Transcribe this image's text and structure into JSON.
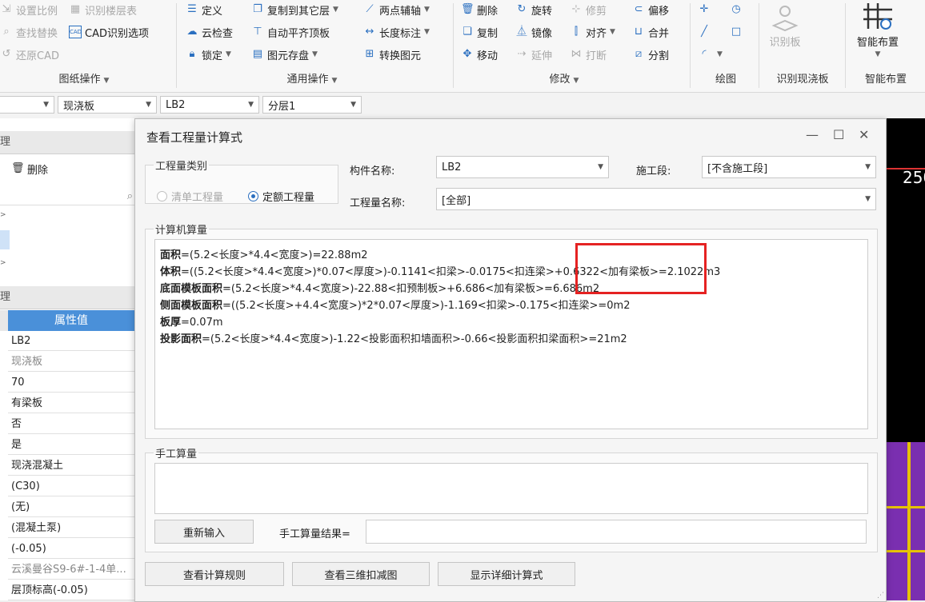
{
  "ribbon": {
    "drawing_ops": {
      "items": [
        {
          "label": "设置比例",
          "icon": "scale-icon",
          "enabled": false
        },
        {
          "label": "识别楼层表",
          "icon": "floor-table-icon",
          "enabled": false
        },
        {
          "label": "查找替换",
          "icon": "find-replace-icon",
          "enabled": false
        },
        {
          "label": "CAD识别选项",
          "icon": "cad-options-icon",
          "enabled": true
        },
        {
          "label": "还原CAD",
          "icon": "restore-cad-icon",
          "enabled": false
        }
      ],
      "group_label": "图纸操作"
    },
    "general_ops": {
      "items": [
        {
          "label": "定义",
          "icon": "define-icon"
        },
        {
          "label": "复制到其它层",
          "icon": "copy-to-layer-icon"
        },
        {
          "label": "两点辅轴",
          "icon": "two-point-axis-icon"
        },
        {
          "label": "云检查",
          "icon": "cloud-check-icon"
        },
        {
          "label": "自动平齐顶板",
          "icon": "auto-align-top-icon"
        },
        {
          "label": "长度标注",
          "icon": "length-dimension-icon"
        },
        {
          "label": "锁定",
          "icon": "lock-icon"
        },
        {
          "label": "图元存盘",
          "icon": "save-element-icon"
        },
        {
          "label": "转换图元",
          "icon": "convert-element-icon"
        }
      ],
      "group_label": "通用操作"
    },
    "modify": {
      "items": [
        {
          "label": "删除",
          "icon": "delete-icon",
          "enabled": true
        },
        {
          "label": "旋转",
          "icon": "rotate-icon",
          "enabled": true
        },
        {
          "label": "修剪",
          "icon": "trim-icon",
          "enabled": false
        },
        {
          "label": "偏移",
          "icon": "offset-icon",
          "enabled": true
        },
        {
          "label": "复制",
          "icon": "copy-icon",
          "enabled": true
        },
        {
          "label": "镜像",
          "icon": "mirror-icon",
          "enabled": true
        },
        {
          "label": "对齐",
          "icon": "align-icon",
          "enabled": true
        },
        {
          "label": "合并",
          "icon": "merge-icon",
          "enabled": true
        },
        {
          "label": "移动",
          "icon": "move-icon",
          "enabled": true
        },
        {
          "label": "延伸",
          "icon": "extend-icon",
          "enabled": false
        },
        {
          "label": "打断",
          "icon": "break-icon",
          "enabled": false
        },
        {
          "label": "分割",
          "icon": "split-icon",
          "enabled": true
        }
      ],
      "group_label": "修改"
    },
    "draw": {
      "group_label": "绘图"
    },
    "identify_slab": {
      "button_label": "识别板",
      "group_label": "识别现浇板"
    },
    "smart_layout": {
      "button_label": "智能布置",
      "group_label": "智能布置"
    }
  },
  "toolbar2": {
    "type_value": "现浇板",
    "component_value": "LB2",
    "layer_value": "分层1"
  },
  "left_panel": {
    "header1": "理",
    "delete_label": "删除",
    "header2": "理",
    "prop_col_header": "属性值",
    "props": [
      "LB2",
      "现浇板",
      "70",
      "有梁板",
      "否",
      "是",
      "现浇混凝土",
      "(C30)",
      "(无)",
      "(混凝土泵)",
      "(-0.05)",
      "云溪曼谷S9-6#-1-4单...",
      "层顶标高(-0.05)"
    ]
  },
  "canvas_right": {
    "number_text": "250"
  },
  "dialog": {
    "title": "查看工程量计算式",
    "qty_category_legend": "工程量类别",
    "radio_list": "清单工程量",
    "radio_quota": "定额工程量",
    "component_name_label": "构件名称:",
    "component_name_value": "LB2",
    "stage_label": "施工段:",
    "stage_value": "[不含施工段]",
    "qty_name_label": "工程量名称:",
    "qty_name_value": "[全部]",
    "computer_calc_legend": "计算机算量",
    "lines": [
      {
        "name": "面积",
        "expr": "=(5.2<长度>*4.4<宽度>)=22.88m2"
      },
      {
        "name": "体积",
        "expr": "=((5.2<长度>*4.4<宽度>)*0.07<厚度>)-0.1141<扣梁>-0.0175<扣连梁>+0.6322<加有梁板>=2.1022m3"
      },
      {
        "name": "底面模板面积",
        "expr": "=(5.2<长度>*4.4<宽度>)-22.88<扣预制板>+6.686<加有梁板>=6.686m2"
      },
      {
        "name": "侧面模板面积",
        "expr": "=((5.2<长度>+4.4<宽度>)*2*0.07<厚度>)-1.169<扣梁>-0.175<扣连梁>=0m2"
      },
      {
        "name": "板厚",
        "expr": "=0.07m"
      },
      {
        "name": "投影面积",
        "expr": "=(5.2<长度>*4.4<宽度>)-1.22<投影面积扣墙面积>-0.66<投影面积扣梁面积>=21m2"
      }
    ],
    "manual_calc_legend": "手工算量",
    "reinput_button": "重新输入",
    "manual_result_label": "手工算量结果=",
    "view_rules_button": "查看计算规则",
    "view_3d_button": "查看三维扣减图",
    "show_detail_button": "显示详细计算式"
  }
}
